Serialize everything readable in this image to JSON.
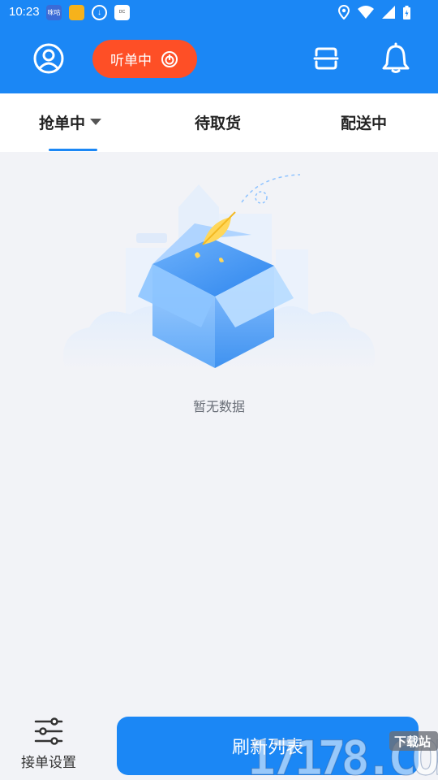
{
  "status_bar": {
    "time": "10:23",
    "notif_labels": [
      "咪咕",
      "",
      "",
      "DC"
    ]
  },
  "header": {
    "listen_label": "听单中"
  },
  "tabs": [
    {
      "label": "抢单中",
      "active": true
    },
    {
      "label": "待取货"
    },
    {
      "label": "配送中"
    }
  ],
  "empty_state": {
    "message": "暂无数据"
  },
  "bottom": {
    "settings_label": "接单设置",
    "refresh_label": "刷新列表"
  },
  "watermark": {
    "brand": "17178.COM",
    "tag": "下载站"
  },
  "colors": {
    "primary": "#1b87f5",
    "accent": "#fe4f26",
    "background": "#f2f3f7"
  },
  "icons": {
    "profile": "user-circle-icon",
    "power": "power-icon",
    "scan": "scan-icon",
    "bell": "bell-icon",
    "settings": "sliders-icon",
    "dropdown": "caret-down-icon"
  }
}
